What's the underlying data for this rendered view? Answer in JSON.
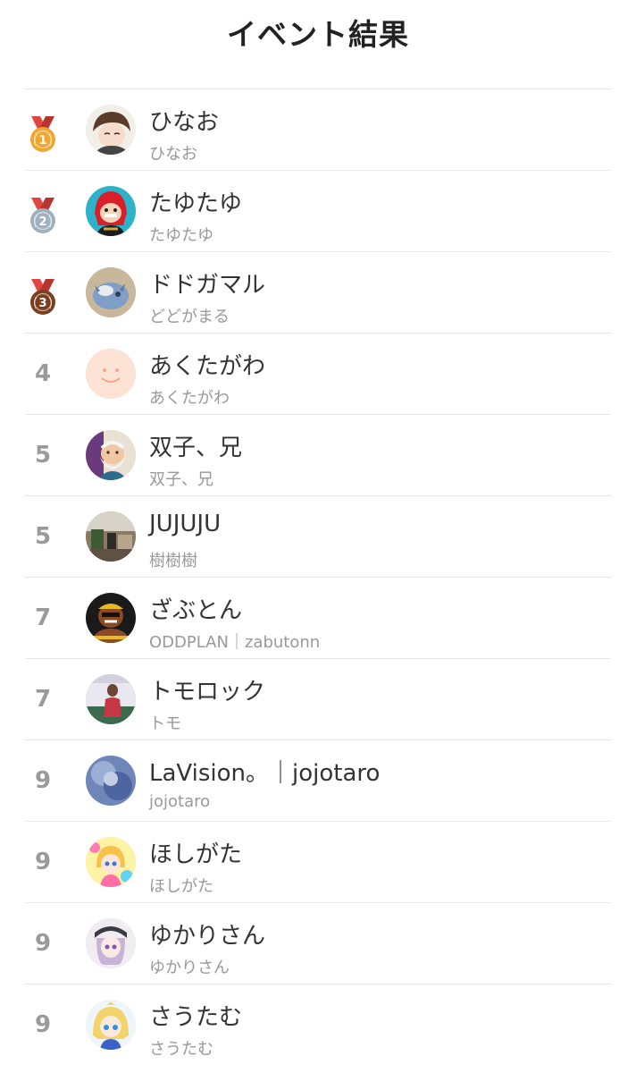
{
  "header": {
    "title": "イベント結果"
  },
  "colors": {
    "gold": "#f0a631",
    "silver": "#9fb1bf",
    "bronze": "#7a3f1f",
    "ribbon": "#e0473f",
    "rank_text": "#9a9a9a",
    "divider": "#e6e6e6"
  },
  "results": [
    {
      "rank": "1",
      "medal": "gold",
      "name": "ひなお",
      "sub": "ひなお",
      "avatar": "boy-sketch"
    },
    {
      "rank": "2",
      "medal": "silver",
      "name": "たゆたゆ",
      "sub": "たゆたゆ",
      "avatar": "red-hair-character"
    },
    {
      "rank": "3",
      "medal": "bronze",
      "name": "ドドガマル",
      "sub": "どどがまる",
      "avatar": "blue-monster-figure"
    },
    {
      "rank": "4",
      "medal": "",
      "name": "あくたがわ",
      "sub": "あくたがわ",
      "avatar": "default-smile"
    },
    {
      "rank": "5",
      "medal": "",
      "name": "双子、兄",
      "sub": "双子、兄",
      "avatar": "bearded-character"
    },
    {
      "rank": "5",
      "medal": "",
      "name": "JUJUJU",
      "sub": "樹樹樹",
      "avatar": "room-photo"
    },
    {
      "rank": "7",
      "medal": "",
      "name": "ざぶとん",
      "sub": "ODDPLAN｜zabutonn",
      "avatar": "muscle-character"
    },
    {
      "rank": "7",
      "medal": "",
      "name": "トモロック",
      "sub": "トモ",
      "avatar": "person-photo"
    },
    {
      "rank": "9",
      "medal": "",
      "name": "LaVision。｜jojotaro",
      "sub": "jojotaro",
      "avatar": "blue-photo"
    },
    {
      "rank": "9",
      "medal": "",
      "name": "ほしがた",
      "sub": "ほしがた",
      "avatar": "colorful-anime-girl"
    },
    {
      "rank": "9",
      "medal": "",
      "name": "ゆかりさん",
      "sub": "ゆかりさん",
      "avatar": "purple-hair-girl"
    },
    {
      "rank": "9",
      "medal": "",
      "name": "さうたむ",
      "sub": "さうたむ",
      "avatar": "blonde-anime-girl"
    }
  ]
}
